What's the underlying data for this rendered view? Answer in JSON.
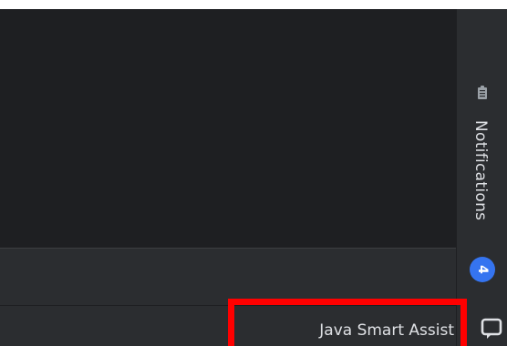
{
  "sidebar": {
    "notifications": {
      "label": "Notifications",
      "count": "4",
      "icon": "clipboard-icon"
    },
    "bottom_icon": "chat-bubble-icon"
  },
  "status_bar": {
    "widget_label": "Java Smart Assist"
  },
  "colors": {
    "editor_bg": "#1e1f22",
    "panel_bg": "#2b2d30",
    "badge": "#3574f0",
    "highlight": "#ff0000",
    "text": "#dfe1e5"
  }
}
